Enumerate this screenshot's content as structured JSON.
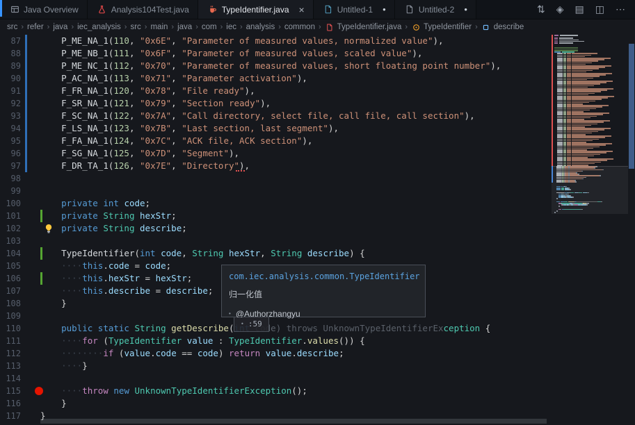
{
  "colors": {
    "accent_blue": "#3794ff",
    "git_modified": "#2f6fb7",
    "git_added": "#55a532",
    "breakpoint_red": "#e51400",
    "minimap_changed_red": "#e05252",
    "scrollbar_blue": "#5682c4"
  },
  "tabs": [
    {
      "label": "Java Overview",
      "icon": "preview-icon"
    },
    {
      "label": "Analysis104Test.java",
      "icon": "beaker-icon"
    },
    {
      "label": "TypeIdentifier.java",
      "icon": "java-file-icon",
      "active": true,
      "close_glyph": "×"
    },
    {
      "label": "Untitled-1",
      "icon": "file-icon-blue",
      "modified": true,
      "modified_glyph": "●"
    },
    {
      "label": "Untitled-2",
      "icon": "file-icon-gray",
      "modified": true,
      "modified_glyph": "●"
    }
  ],
  "tab_actions": [
    {
      "name": "toggle-changes-icon",
      "glyph": "⇅"
    },
    {
      "name": "run-icon",
      "glyph": "◈"
    },
    {
      "name": "notebook-icon",
      "glyph": "▤"
    },
    {
      "name": "split-editor-icon",
      "glyph": "◫"
    },
    {
      "name": "more-actions-icon",
      "glyph": "⋯"
    }
  ],
  "breadcrumb": {
    "separator": "›",
    "items": [
      {
        "label": "src"
      },
      {
        "label": "refer"
      },
      {
        "label": "java"
      },
      {
        "label": "iec_analysis"
      },
      {
        "label": "src"
      },
      {
        "label": "main"
      },
      {
        "label": "java"
      },
      {
        "label": "com"
      },
      {
        "label": "iec"
      },
      {
        "label": "analysis"
      },
      {
        "label": "common"
      },
      {
        "label": "TypeIdentifier.java",
        "icon": "file-red-icon"
      },
      {
        "label": "TypeIdentifier",
        "icon": "class-icon"
      },
      {
        "label": "describe",
        "icon": "field-icon"
      }
    ]
  },
  "hover": {
    "qualified_name": "com.iec.analysis.common.TypeIdentifier",
    "doc": "归一化值",
    "author_bullet": "•",
    "author": "@Authorzhangyu",
    "badge_bullet": "•",
    "badge": ":59"
  },
  "editor": {
    "lines": [
      {
        "n": 87,
        "g": "m",
        "t": [
          [
            "    ",
            "p"
          ],
          [
            "P_ME_NA_1",
            "w"
          ],
          [
            "(",
            "p"
          ],
          [
            "110",
            "num"
          ],
          [
            ", ",
            "p"
          ],
          [
            "\"0x6E\"",
            "s"
          ],
          [
            ", ",
            "p"
          ],
          [
            "\"Parameter of measured values, normalized value\"",
            "s"
          ],
          [
            "),",
            "p"
          ]
        ]
      },
      {
        "n": 88,
        "g": "m",
        "t": [
          [
            "    ",
            "p"
          ],
          [
            "P_ME_NB_1",
            "w"
          ],
          [
            "(",
            "p"
          ],
          [
            "111",
            "num"
          ],
          [
            ", ",
            "p"
          ],
          [
            "\"0x6F\"",
            "s"
          ],
          [
            ", ",
            "p"
          ],
          [
            "\"Parameter of measured values, scaled value\"",
            "s"
          ],
          [
            "),",
            "p"
          ]
        ]
      },
      {
        "n": 89,
        "g": "m",
        "t": [
          [
            "    ",
            "p"
          ],
          [
            "P_ME_NC_1",
            "w"
          ],
          [
            "(",
            "p"
          ],
          [
            "112",
            "num"
          ],
          [
            ", ",
            "p"
          ],
          [
            "\"0x70\"",
            "s"
          ],
          [
            ", ",
            "p"
          ],
          [
            "\"Parameter of measured values, short floating point number\"",
            "s"
          ],
          [
            "),",
            "p"
          ]
        ]
      },
      {
        "n": 90,
        "g": "m",
        "t": [
          [
            "    ",
            "p"
          ],
          [
            "P_AC_NA_1",
            "w"
          ],
          [
            "(",
            "p"
          ],
          [
            "113",
            "num"
          ],
          [
            ", ",
            "p"
          ],
          [
            "\"0x71\"",
            "s"
          ],
          [
            ", ",
            "p"
          ],
          [
            "\"Parameter activation\"",
            "s"
          ],
          [
            "),",
            "p"
          ]
        ]
      },
      {
        "n": 91,
        "g": "m",
        "t": [
          [
            "    ",
            "p"
          ],
          [
            "F_FR_NA_1",
            "w"
          ],
          [
            "(",
            "p"
          ],
          [
            "120",
            "num"
          ],
          [
            ", ",
            "p"
          ],
          [
            "\"0x78\"",
            "s"
          ],
          [
            ", ",
            "p"
          ],
          [
            "\"File ready\"",
            "s"
          ],
          [
            "),",
            "p"
          ]
        ]
      },
      {
        "n": 92,
        "g": "m",
        "t": [
          [
            "    ",
            "p"
          ],
          [
            "F_SR_NA_1",
            "w"
          ],
          [
            "(",
            "p"
          ],
          [
            "121",
            "num"
          ],
          [
            ", ",
            "p"
          ],
          [
            "\"0x79\"",
            "s"
          ],
          [
            ", ",
            "p"
          ],
          [
            "\"Section ready\"",
            "s"
          ],
          [
            "),",
            "p"
          ]
        ]
      },
      {
        "n": 93,
        "g": "m",
        "t": [
          [
            "    ",
            "p"
          ],
          [
            "F_SC_NA_1",
            "w"
          ],
          [
            "(",
            "p"
          ],
          [
            "122",
            "num"
          ],
          [
            ", ",
            "p"
          ],
          [
            "\"0x7A\"",
            "s"
          ],
          [
            ", ",
            "p"
          ],
          [
            "\"Call directory, select file, call file, call section\"",
            "s"
          ],
          [
            "),",
            "p"
          ]
        ]
      },
      {
        "n": 94,
        "g": "m",
        "t": [
          [
            "    ",
            "p"
          ],
          [
            "F_LS_NA_1",
            "w"
          ],
          [
            "(",
            "p"
          ],
          [
            "123",
            "num"
          ],
          [
            ", ",
            "p"
          ],
          [
            "\"0x7B\"",
            "s"
          ],
          [
            ", ",
            "p"
          ],
          [
            "\"Last section, last segment\"",
            "s"
          ],
          [
            "),",
            "p"
          ]
        ]
      },
      {
        "n": 95,
        "g": "m",
        "t": [
          [
            "    ",
            "p"
          ],
          [
            "F_FA_NA_1",
            "w"
          ],
          [
            "(",
            "p"
          ],
          [
            "124",
            "num"
          ],
          [
            ", ",
            "p"
          ],
          [
            "\"0x7C\"",
            "s"
          ],
          [
            ", ",
            "p"
          ],
          [
            "\"ACK file, ACK section\"",
            "s"
          ],
          [
            "),",
            "p"
          ]
        ]
      },
      {
        "n": 96,
        "g": "m",
        "t": [
          [
            "    ",
            "p"
          ],
          [
            "F_SG_NA_1",
            "w"
          ],
          [
            "(",
            "p"
          ],
          [
            "125",
            "num"
          ],
          [
            ", ",
            "p"
          ],
          [
            "\"0x7D\"",
            "s"
          ],
          [
            ", ",
            "p"
          ],
          [
            "\"Segment\"",
            "s"
          ],
          [
            "),",
            "p"
          ]
        ]
      },
      {
        "n": 97,
        "g": "m",
        "d": "squig",
        "t": [
          [
            "    ",
            "p"
          ],
          [
            "F_DR_TA_1",
            "w"
          ],
          [
            "(",
            "p"
          ],
          [
            "126",
            "num"
          ],
          [
            ", ",
            "p"
          ],
          [
            "\"0x7E\"",
            "s"
          ],
          [
            ", ",
            "p"
          ],
          [
            "\"Directory\"",
            "s"
          ],
          [
            "),",
            "p"
          ]
        ]
      },
      {
        "n": 98,
        "t": []
      },
      {
        "n": 99,
        "t": []
      },
      {
        "n": 100,
        "t": [
          [
            "    ",
            "p"
          ],
          [
            "private",
            "k"
          ],
          [
            " ",
            "p"
          ],
          [
            "int",
            "k"
          ],
          [
            " ",
            "p"
          ],
          [
            "code",
            "v"
          ],
          [
            ";",
            "p"
          ]
        ]
      },
      {
        "n": 101,
        "g": "a",
        "t": [
          [
            "    ",
            "p"
          ],
          [
            "private",
            "k"
          ],
          [
            " ",
            "p"
          ],
          [
            "String",
            "y"
          ],
          [
            " ",
            "p"
          ],
          [
            "hexStr",
            "v"
          ],
          [
            ";",
            "p"
          ]
        ]
      },
      {
        "n": 102,
        "d": "bulb",
        "t": [
          [
            "    ",
            "p"
          ],
          [
            "private",
            "k"
          ],
          [
            " ",
            "p"
          ],
          [
            "String",
            "y"
          ],
          [
            " ",
            "p"
          ],
          [
            "describe",
            "v"
          ],
          [
            ";",
            "p"
          ]
        ]
      },
      {
        "n": 103,
        "t": []
      },
      {
        "n": 104,
        "g": "a",
        "t": [
          [
            "    ",
            "p"
          ],
          [
            "TypeIdentifier",
            "w"
          ],
          [
            "(",
            "p"
          ],
          [
            "int",
            "k"
          ],
          [
            " ",
            "p"
          ],
          [
            "code",
            "v"
          ],
          [
            ", ",
            "p"
          ],
          [
            "String",
            "y"
          ],
          [
            " ",
            "p"
          ],
          [
            "hexStr",
            "v"
          ],
          [
            ", ",
            "p"
          ],
          [
            "String",
            "y"
          ],
          [
            " ",
            "p"
          ],
          [
            "describe",
            "v"
          ],
          [
            ") {",
            "p"
          ]
        ]
      },
      {
        "n": 105,
        "t": [
          [
            "    ",
            "p"
          ],
          [
            "····",
            "d"
          ],
          [
            "this",
            "k"
          ],
          [
            ".",
            "p"
          ],
          [
            "code",
            "v"
          ],
          [
            " = ",
            "p"
          ],
          [
            "code",
            "v"
          ],
          [
            ";",
            "p"
          ]
        ]
      },
      {
        "n": 106,
        "g": "a",
        "t": [
          [
            "    ",
            "p"
          ],
          [
            "····",
            "d"
          ],
          [
            "this",
            "k"
          ],
          [
            ".",
            "p"
          ],
          [
            "hexStr",
            "v"
          ],
          [
            " = ",
            "p"
          ],
          [
            "hexStr",
            "v"
          ],
          [
            ";",
            "p"
          ]
        ]
      },
      {
        "n": 107,
        "t": [
          [
            "    ",
            "p"
          ],
          [
            "····",
            "d"
          ],
          [
            "this",
            "k"
          ],
          [
            ".",
            "p"
          ],
          [
            "describe",
            "v"
          ],
          [
            " = ",
            "p"
          ],
          [
            "describe",
            "v"
          ],
          [
            ";",
            "p"
          ]
        ]
      },
      {
        "n": 108,
        "t": [
          [
            "    ",
            "p"
          ],
          [
            "}",
            "p"
          ]
        ]
      },
      {
        "n": 109,
        "t": []
      },
      {
        "n": 110,
        "t": [
          [
            "    ",
            "p"
          ],
          [
            "public",
            "k"
          ],
          [
            " ",
            "p"
          ],
          [
            "static",
            "k"
          ],
          [
            " ",
            "p"
          ],
          [
            "String",
            "y"
          ],
          [
            " ",
            "p"
          ],
          [
            "getDescribe",
            "f"
          ],
          [
            "(",
            "p"
          ],
          [
            "int",
            "k"
          ],
          [
            " code) throws UnknownTypeIdentifierEx",
            "x"
          ],
          [
            "ception",
            "y"
          ],
          [
            " {",
            "p"
          ]
        ]
      },
      {
        "n": 111,
        "t": [
          [
            "    ",
            "p"
          ],
          [
            "····",
            "d"
          ],
          [
            "for",
            "c"
          ],
          [
            " (",
            "p"
          ],
          [
            "TypeIdentifier",
            "y"
          ],
          [
            " ",
            "p"
          ],
          [
            "value",
            "v"
          ],
          [
            " : ",
            "p"
          ],
          [
            "TypeIdentifier",
            "y"
          ],
          [
            ".",
            "p"
          ],
          [
            "values",
            "f"
          ],
          [
            "()) {",
            "p"
          ]
        ]
      },
      {
        "n": 112,
        "t": [
          [
            "    ",
            "p"
          ],
          [
            "········",
            "d"
          ],
          [
            "if",
            "c"
          ],
          [
            " (",
            "p"
          ],
          [
            "value",
            "v"
          ],
          [
            ".",
            "p"
          ],
          [
            "code",
            "v"
          ],
          [
            " == ",
            "p"
          ],
          [
            "code",
            "v"
          ],
          [
            ") ",
            "p"
          ],
          [
            "return",
            "c"
          ],
          [
            " ",
            "p"
          ],
          [
            "value",
            "v"
          ],
          [
            ".",
            "p"
          ],
          [
            "describe",
            "v"
          ],
          [
            ";",
            "p"
          ]
        ]
      },
      {
        "n": 113,
        "t": [
          [
            "    ",
            "p"
          ],
          [
            "····",
            "d"
          ],
          [
            "}",
            "p"
          ]
        ]
      },
      {
        "n": 114,
        "t": []
      },
      {
        "n": 115,
        "d": "bp",
        "t": [
          [
            "    ",
            "p"
          ],
          [
            "····",
            "d"
          ],
          [
            "throw",
            "c"
          ],
          [
            " ",
            "p"
          ],
          [
            "new",
            "k"
          ],
          [
            " ",
            "p"
          ],
          [
            "UnknownTypeIdentifierException",
            "y"
          ],
          [
            "();",
            "p"
          ]
        ]
      },
      {
        "n": 116,
        "t": [
          [
            "    ",
            "p"
          ],
          [
            "}",
            "p"
          ]
        ]
      },
      {
        "n": 117,
        "t": [
          [
            "}",
            "p"
          ]
        ]
      }
    ]
  }
}
